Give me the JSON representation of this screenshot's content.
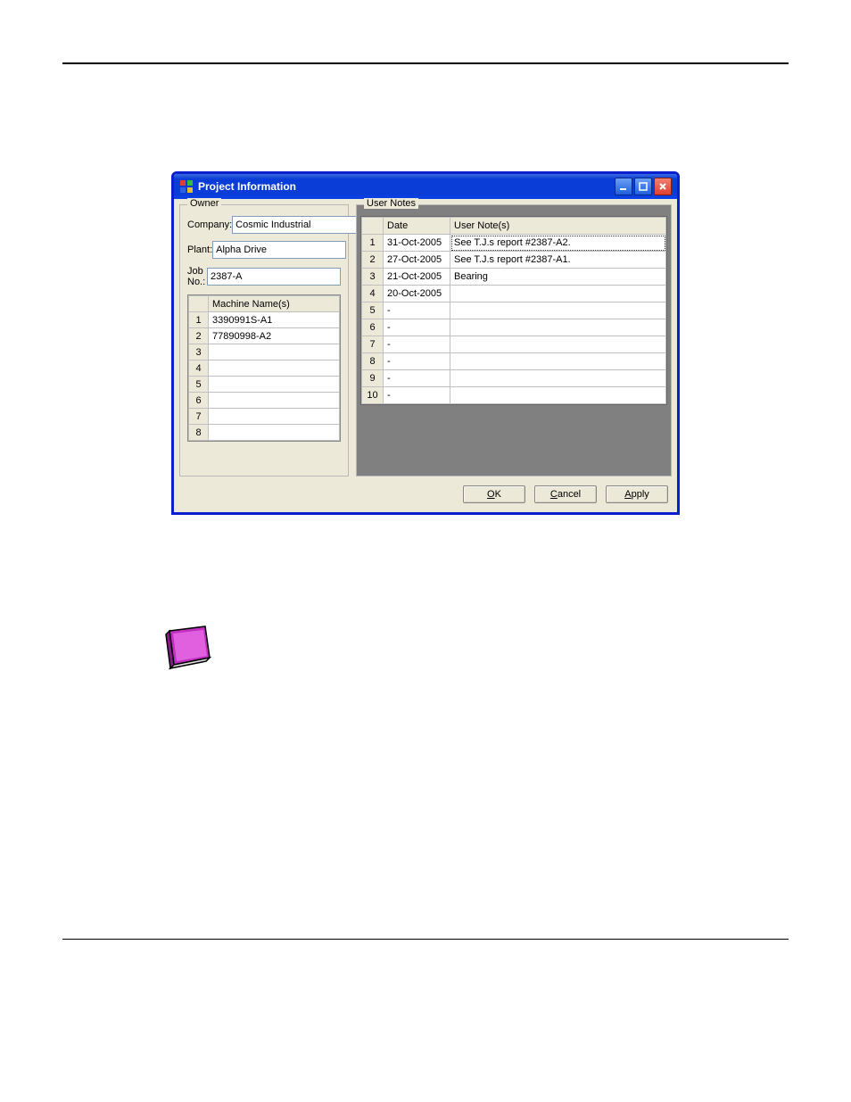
{
  "window": {
    "title": "Project Information"
  },
  "owner": {
    "group_label": "Owner",
    "company_label": "Company:",
    "company_value": "Cosmic Industrial",
    "plant_label": "Plant:",
    "plant_value": "Alpha Drive",
    "jobno_label": "Job No.:",
    "jobno_value": "2387-A",
    "machine_header": "Machine Name(s)",
    "machines": [
      "3390991S-A1",
      "77890998-A2",
      "",
      "",
      "",
      "",
      "",
      ""
    ]
  },
  "notes": {
    "group_label": "User Notes",
    "date_header": "Date",
    "note_header": "User Note(s)",
    "rows": [
      {
        "date": "31-Oct-2005",
        "note": "See T.J.s report #2387-A2."
      },
      {
        "date": "27-Oct-2005",
        "note": "See T.J.s report #2387-A1."
      },
      {
        "date": "21-Oct-2005",
        "note": "Bearing"
      },
      {
        "date": "20-Oct-2005",
        "note": ""
      },
      {
        "date": "-",
        "note": ""
      },
      {
        "date": "-",
        "note": ""
      },
      {
        "date": "-",
        "note": ""
      },
      {
        "date": "-",
        "note": ""
      },
      {
        "date": "-",
        "note": ""
      },
      {
        "date": "-",
        "note": ""
      }
    ]
  },
  "buttons": {
    "ok": "OK",
    "cancel": "Cancel",
    "apply": "Apply"
  }
}
